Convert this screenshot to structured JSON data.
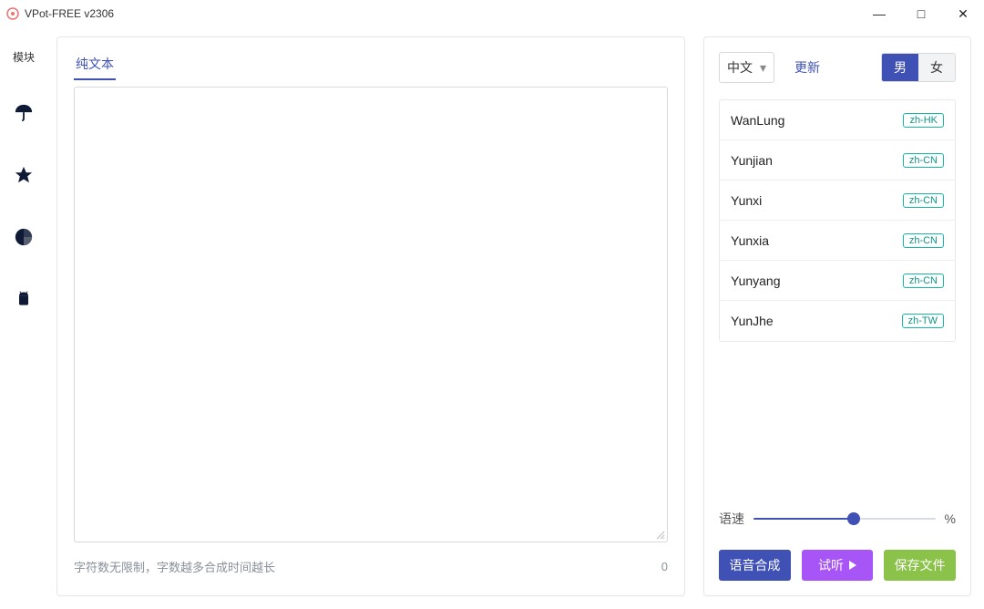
{
  "window": {
    "title": "VPot-FREE v2306",
    "icons": {
      "minimize": "—",
      "maximize": "□",
      "close": "✕"
    }
  },
  "sidebar": {
    "module_label": "模块"
  },
  "editor": {
    "tab_label": "纯文本",
    "placeholder": "",
    "hint": "字符数无限制，字数越多合成时间越长",
    "char_count": "0"
  },
  "right": {
    "lang_label": "中文",
    "refresh_label": "更新",
    "gender": {
      "male": "男",
      "female": "女"
    },
    "voices": [
      {
        "name": "WanLung",
        "tag": "zh-HK"
      },
      {
        "name": "Yunjian",
        "tag": "zh-CN"
      },
      {
        "name": "Yunxi",
        "tag": "zh-CN"
      },
      {
        "name": "Yunxia",
        "tag": "zh-CN"
      },
      {
        "name": "Yunyang",
        "tag": "zh-CN"
      },
      {
        "name": "YunJhe",
        "tag": "zh-TW"
      }
    ],
    "speed": {
      "label": "语速",
      "unit": "%",
      "value_percent": 55
    },
    "buttons": {
      "synthesize": "语音合成",
      "preview": "试听",
      "save": "保存文件"
    }
  }
}
